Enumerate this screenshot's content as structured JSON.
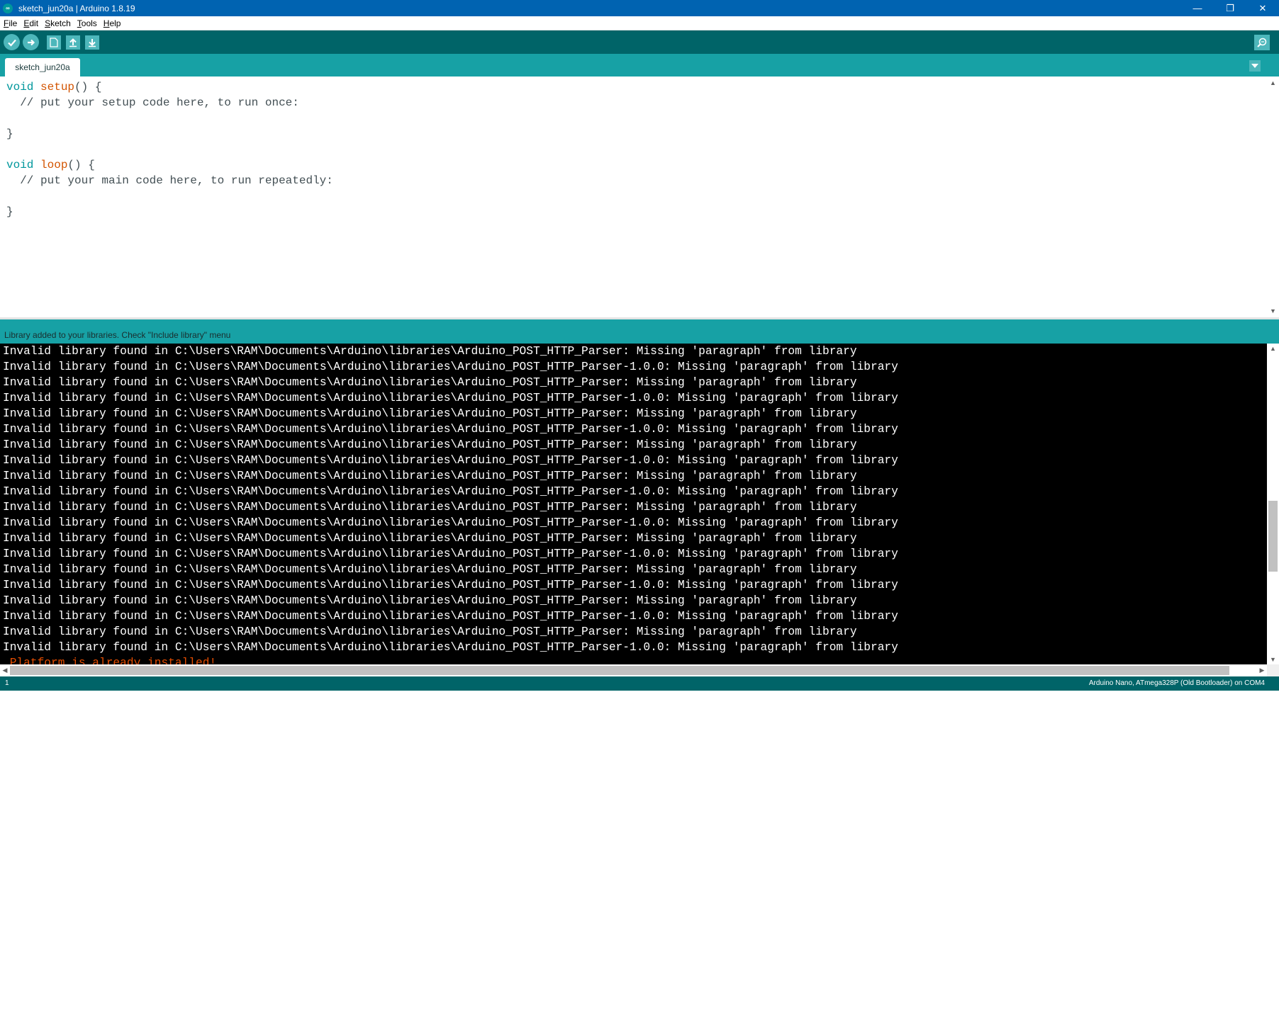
{
  "window": {
    "title": "sketch_jun20a | Arduino 1.8.19",
    "icon": "arduino-logo-icon",
    "controls": {
      "minimize": "—",
      "restore": "❐",
      "close": "✕"
    }
  },
  "menu": [
    {
      "first": "F",
      "rest": "ile"
    },
    {
      "first": "E",
      "rest": "dit"
    },
    {
      "first": "S",
      "rest": "ketch"
    },
    {
      "first": "T",
      "rest": "ools"
    },
    {
      "first": "H",
      "rest": "elp"
    }
  ],
  "toolbar": {
    "buttons": [
      "verify-icon",
      "upload-icon",
      "new-icon",
      "open-icon",
      "save-icon"
    ],
    "serial_monitor": "serial-monitor-icon"
  },
  "tabs": [
    {
      "label": "sketch_jun20a"
    }
  ],
  "editor": {
    "lines": [
      {
        "kw": "void",
        "fn": "setup",
        "rest": "() {"
      },
      {
        "text": "  // put your setup code here, to run once:"
      },
      {
        "text": ""
      },
      {
        "text": "}"
      },
      {
        "text": ""
      },
      {
        "kw": "void",
        "fn": "loop",
        "rest": "() {"
      },
      {
        "text": "  // put your main code here, to run repeatedly:"
      },
      {
        "text": ""
      },
      {
        "text": "}"
      }
    ]
  },
  "status": {
    "message": "Library added to your libraries. Check \"Include library\" menu"
  },
  "console": {
    "lines": [
      "Invalid library found in C:\\Users\\RAM\\Documents\\Arduino\\libraries\\Arduino_POST_HTTP_Parser: Missing 'paragraph' from library",
      "Invalid library found in C:\\Users\\RAM\\Documents\\Arduino\\libraries\\Arduino_POST_HTTP_Parser-1.0.0: Missing 'paragraph' from library",
      "Invalid library found in C:\\Users\\RAM\\Documents\\Arduino\\libraries\\Arduino_POST_HTTP_Parser: Missing 'paragraph' from library",
      "Invalid library found in C:\\Users\\RAM\\Documents\\Arduino\\libraries\\Arduino_POST_HTTP_Parser-1.0.0: Missing 'paragraph' from library",
      "Invalid library found in C:\\Users\\RAM\\Documents\\Arduino\\libraries\\Arduino_POST_HTTP_Parser: Missing 'paragraph' from library",
      "Invalid library found in C:\\Users\\RAM\\Documents\\Arduino\\libraries\\Arduino_POST_HTTP_Parser-1.0.0: Missing 'paragraph' from library",
      "Invalid library found in C:\\Users\\RAM\\Documents\\Arduino\\libraries\\Arduino_POST_HTTP_Parser: Missing 'paragraph' from library",
      "Invalid library found in C:\\Users\\RAM\\Documents\\Arduino\\libraries\\Arduino_POST_HTTP_Parser-1.0.0: Missing 'paragraph' from library",
      "Invalid library found in C:\\Users\\RAM\\Documents\\Arduino\\libraries\\Arduino_POST_HTTP_Parser: Missing 'paragraph' from library",
      "Invalid library found in C:\\Users\\RAM\\Documents\\Arduino\\libraries\\Arduino_POST_HTTP_Parser-1.0.0: Missing 'paragraph' from library",
      "Invalid library found in C:\\Users\\RAM\\Documents\\Arduino\\libraries\\Arduino_POST_HTTP_Parser: Missing 'paragraph' from library",
      "Invalid library found in C:\\Users\\RAM\\Documents\\Arduino\\libraries\\Arduino_POST_HTTP_Parser-1.0.0: Missing 'paragraph' from library",
      "Invalid library found in C:\\Users\\RAM\\Documents\\Arduino\\libraries\\Arduino_POST_HTTP_Parser: Missing 'paragraph' from library",
      "Invalid library found in C:\\Users\\RAM\\Documents\\Arduino\\libraries\\Arduino_POST_HTTP_Parser-1.0.0: Missing 'paragraph' from library",
      "Invalid library found in C:\\Users\\RAM\\Documents\\Arduino\\libraries\\Arduino_POST_HTTP_Parser: Missing 'paragraph' from library",
      "Invalid library found in C:\\Users\\RAM\\Documents\\Arduino\\libraries\\Arduino_POST_HTTP_Parser-1.0.0: Missing 'paragraph' from library",
      "Invalid library found in C:\\Users\\RAM\\Documents\\Arduino\\libraries\\Arduino_POST_HTTP_Parser: Missing 'paragraph' from library",
      "Invalid library found in C:\\Users\\RAM\\Documents\\Arduino\\libraries\\Arduino_POST_HTTP_Parser-1.0.0: Missing 'paragraph' from library",
      "Invalid library found in C:\\Users\\RAM\\Documents\\Arduino\\libraries\\Arduino_POST_HTTP_Parser: Missing 'paragraph' from library",
      "Invalid library found in C:\\Users\\RAM\\Documents\\Arduino\\libraries\\Arduino_POST_HTTP_Parser-1.0.0: Missing 'paragraph' from library"
    ],
    "error_line": " Platform is already installed!"
  },
  "footer": {
    "line_number": "1",
    "board": "Arduino Nano, ATmega328P (Old Bootloader) on COM4"
  },
  "colors": {
    "titlebar": "#0063b1",
    "toolbar": "#006468",
    "tabbar": "#17a1a5",
    "accent": "#4db7bb",
    "console_bg": "#000000",
    "error_text": "#e34c00"
  }
}
